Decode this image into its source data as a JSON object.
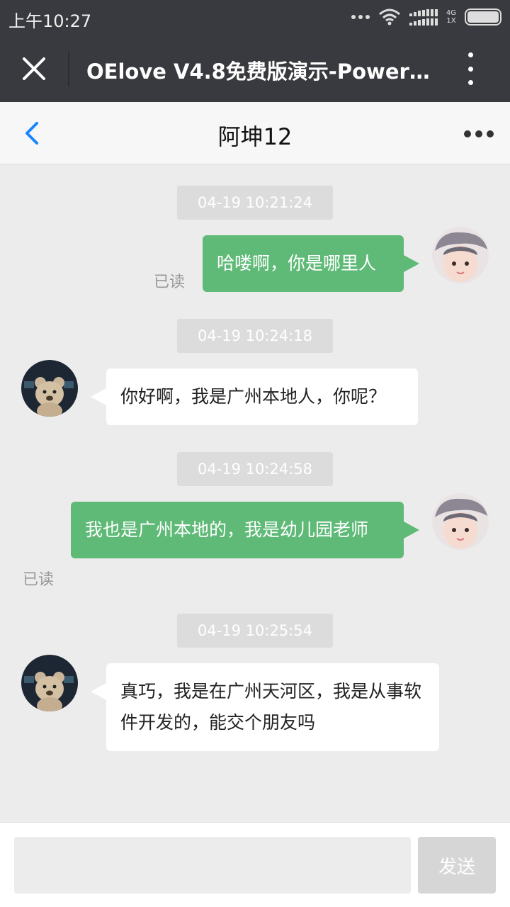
{
  "status_bar": {
    "time": "上午10:27",
    "network_top": "4G",
    "network_bottom": "1X"
  },
  "title_bar": {
    "title": "OElove V4.8免费版演示-Powered..."
  },
  "chat_header": {
    "contact_name": "阿坤12"
  },
  "messages": [
    {
      "timestamp": "04-19 10:21:24",
      "sender": "me",
      "text": "哈喽啊，你是哪里人",
      "status": "已读"
    },
    {
      "timestamp": "04-19 10:24:18",
      "sender": "other",
      "text": "你好啊，我是广州本地人，你呢？"
    },
    {
      "timestamp": "04-19 10:24:58",
      "sender": "me",
      "text": "我也是广州本地的，我是幼儿园老师",
      "status": "已读"
    },
    {
      "timestamp": "04-19 10:25:54",
      "sender": "other",
      "text": "真巧，我是在广州天河区，我是从事软件开发的，能交个朋友吗"
    }
  ],
  "input_bar": {
    "placeholder": "",
    "send_label": "发送"
  },
  "colors": {
    "bar_bg": "#393a3f",
    "me_bubble": "#5fba77",
    "other_bubble": "#ffffff",
    "chat_bg": "#ececec",
    "back_accent": "#1a85ff"
  }
}
